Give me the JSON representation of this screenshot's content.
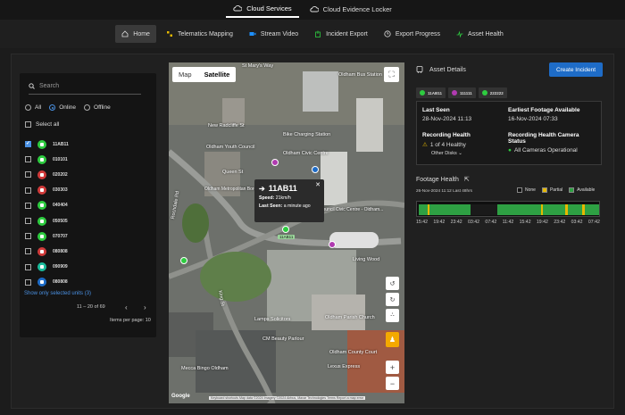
{
  "topbar": {
    "tabs": [
      {
        "label": "Cloud Services",
        "active": true,
        "icon": "cloud-upload-icon"
      },
      {
        "label": "Cloud Evidence Locker",
        "active": false,
        "icon": "cloud-lock-icon"
      }
    ]
  },
  "nav": {
    "items": [
      {
        "label": "Home",
        "icon": "home-icon",
        "active": true
      },
      {
        "label": "Telematics Mapping",
        "icon": "map-pin-icon"
      },
      {
        "label": "Stream Video",
        "icon": "video-icon"
      },
      {
        "label": "Incident Export",
        "icon": "export-icon"
      },
      {
        "label": "Export Progress",
        "icon": "progress-icon"
      },
      {
        "label": "Asset Health",
        "icon": "health-icon"
      }
    ]
  },
  "sidebar": {
    "search_placeholder": "Search",
    "filters": [
      "All",
      "Online",
      "Offline"
    ],
    "selected_filter": "Online",
    "select_all_label": "Select all",
    "units": [
      {
        "id": "11AB11",
        "color": "#2ecc40",
        "checked": true
      },
      {
        "id": "010101",
        "color": "#2ecc40",
        "checked": false
      },
      {
        "id": "020202",
        "color": "#d03a3a",
        "checked": false
      },
      {
        "id": "030303",
        "color": "#d03a3a",
        "checked": false
      },
      {
        "id": "040404",
        "color": "#2ecc40",
        "checked": false
      },
      {
        "id": "050505",
        "color": "#2ecc40",
        "checked": false
      },
      {
        "id": "070707",
        "color": "#2ecc40",
        "checked": false
      },
      {
        "id": "080808",
        "color": "#d03a3a",
        "checked": false
      },
      {
        "id": "090909",
        "color": "#1abc9c",
        "checked": false
      },
      {
        "id": "080808",
        "color": "#1e6cc7",
        "checked": false
      }
    ],
    "show_selected_link": "Show only selected units (3)",
    "pagination": "11 – 20 of 69",
    "items_per_page": "Items per page: 10"
  },
  "map": {
    "types": [
      "Map",
      "Satellite"
    ],
    "selected_type": "Satellite",
    "popup": {
      "title": "11AB11",
      "speed_label": "Speed:",
      "speed_value": "21km/h",
      "last_seen_label": "Last Seen:",
      "last_seen_value": "a minute ago"
    },
    "vehicle_label": "11AB11",
    "place_labels": [
      "St Mary's Way",
      "New Radcliffe St",
      "Oldham Youth Council",
      "Queen St",
      "Oldham Metropolitan Borough Council",
      "Oldham Civic Centre",
      "Rochdale Rd",
      "Oldham Council Civic Centre - Oldham...",
      "Living Wood",
      "King St",
      "Oldham Parish Church",
      "Oldham County Court",
      "CM Beauty Parlour",
      "Mecca Bingo Oldham",
      "Lamps Solicitors",
      "Lexus Express",
      "Oldham Bus Station",
      "Bike Charging Station"
    ],
    "attribution": "Keyboard shortcuts    Map data ©2024 Imagery ©2024 Airbus, Maxar Technologies   Terms   Report a map error",
    "brand": "Google"
  },
  "details": {
    "header": "Asset Details",
    "create_button": "Create Incident",
    "chips": [
      {
        "label": "11AB11",
        "color": "#2ecc40"
      },
      {
        "label": "111111",
        "color": "#b03ab0"
      },
      {
        "label": "222222",
        "color": "#2ecc40"
      }
    ],
    "last_seen_label": "Last Seen",
    "last_seen_value": "28-Nov-2024 11:13",
    "earliest_label": "Earliest Footage Available",
    "earliest_value": "16-Nov-2024 07:33",
    "rec_health_label": "Recording Health",
    "rec_health_value": "1 of 4 Healthy",
    "other_disks": "Other Disks",
    "camera_status_label": "Recording Health Camera Status",
    "camera_status_value": "All Cameras Operational"
  },
  "footage": {
    "title": "Footage Health",
    "range": "26-Nov-2024 11:12 Last 48hrs",
    "legend": [
      {
        "label": "None",
        "color": "#111111"
      },
      {
        "label": "Partial",
        "color": "#e6b800"
      },
      {
        "label": "Available",
        "color": "#2ea043"
      }
    ],
    "ticks": [
      "15:42",
      "19:42",
      "23:42",
      "03:42",
      "07:42",
      "11:42",
      "15:42",
      "19:42",
      "23:42",
      "03:42",
      "07:42"
    ]
  }
}
